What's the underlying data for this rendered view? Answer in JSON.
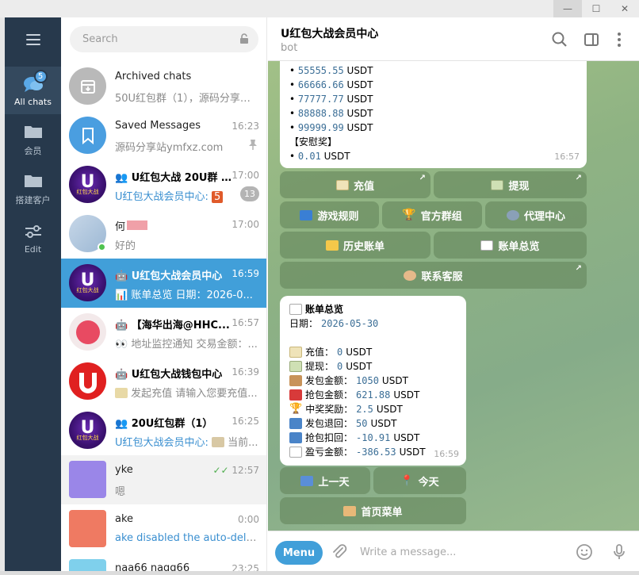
{
  "window": {
    "min": "—",
    "max": "☐",
    "close": "✕"
  },
  "rail": {
    "items": [
      {
        "label": "All chats",
        "badge": "5"
      },
      {
        "label": "会员"
      },
      {
        "label": "搭建客户"
      },
      {
        "label": "Edit"
      }
    ]
  },
  "search": {
    "placeholder": "Search"
  },
  "chats": [
    {
      "name": "Archived chats",
      "preview": "50U红包群（1），源码分享站...",
      "time": ""
    },
    {
      "name": "Saved Messages",
      "preview": "源码分享站ymfxz.com",
      "time": "16:23"
    },
    {
      "name": "U红包大战 20U群 (...",
      "preview_prefix": "U红包大战会员中心: ",
      "preview": "5",
      "time": "17:00",
      "unread": "13"
    },
    {
      "name": "何",
      "preview": "好的",
      "time": "17:00"
    },
    {
      "name": "U红包大战会员中心",
      "preview": "📊 账单总览 日期：2026-0...",
      "time": "16:59"
    },
    {
      "name": "【海华出海@HHC...",
      "preview": "👀 地址监控通知 交易金额：...",
      "time": "16:57"
    },
    {
      "name": "U红包大战钱包中心",
      "preview": "发起充值 请输入您要充值...",
      "time": "16:39"
    },
    {
      "name": "20U红包群（1）",
      "preview_prefix": "U红包大战会员中心: ",
      "preview": "当前...",
      "time": "16:25"
    },
    {
      "name": "yke",
      "preview": "嗯",
      "time": "12:57"
    },
    {
      "name": "ake",
      "preview": "ake disabled the auto-dele...",
      "time": "0:00"
    },
    {
      "name": "naa66 nagg66",
      "preview": "",
      "time": "23:25"
    }
  ],
  "avatar_text": {
    "u": "U",
    "u_sub": "红包大战"
  },
  "header": {
    "title": "U红包大战会员中心",
    "subtitle": "bot"
  },
  "message1": {
    "lines": [
      {
        "amount": "55555.55",
        "unit": "USDT"
      },
      {
        "amount": "66666.66",
        "unit": "USDT"
      },
      {
        "amount": "77777.77",
        "unit": "USDT"
      },
      {
        "amount": "88888.88",
        "unit": "USDT"
      },
      {
        "amount": "99999.99",
        "unit": "USDT"
      }
    ],
    "consolation_label": "【安慰奖】",
    "consolation": {
      "amount": "0.01",
      "unit": "USDT"
    },
    "time": "16:57"
  },
  "keyboard1": {
    "recharge": "充值",
    "withdraw": "提现",
    "rules": "游戏规则",
    "group": "官方群组",
    "agent": "代理中心",
    "history": "历史账单",
    "overview": "账单总览",
    "support": "联系客服"
  },
  "message2": {
    "title": "账单总览",
    "date_label": "日期：",
    "date": "2026-05-30",
    "rows": [
      {
        "label": "充值：",
        "value": "0",
        "unit": "USDT"
      },
      {
        "label": "提现：",
        "value": "0",
        "unit": "USDT"
      },
      {
        "label": "发包金额：",
        "value": "1050",
        "unit": "USDT"
      },
      {
        "label": "抢包金额：",
        "value": "621.88",
        "unit": "USDT"
      },
      {
        "label": "中奖奖励：",
        "value": "2.5",
        "unit": "USDT"
      },
      {
        "label": "发包退回：",
        "value": "50",
        "unit": "USDT"
      },
      {
        "label": "抢包扣回：",
        "value": "-10.91",
        "unit": "USDT"
      },
      {
        "label": "盈亏金额：",
        "value": "-386.53",
        "unit": "USDT"
      }
    ],
    "time": "16:59"
  },
  "keyboard2": {
    "prev": "上一天",
    "today": "今天",
    "home": "首页菜单"
  },
  "composer": {
    "menu": "Menu",
    "placeholder": "Write a message..."
  },
  "colors": {
    "accent": "#419fd9",
    "rail": "#27394c",
    "unread": "#b4b4b4"
  }
}
